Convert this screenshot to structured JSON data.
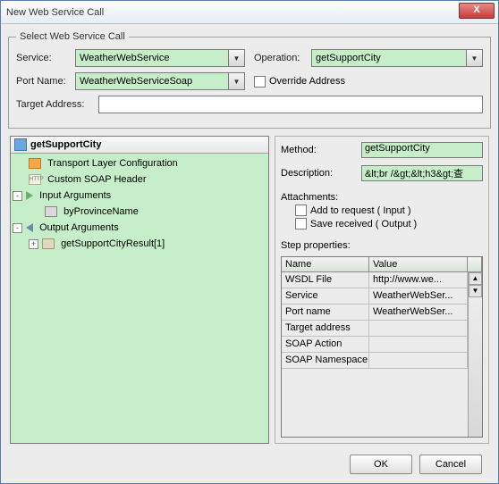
{
  "window": {
    "title": "New Web Service Call",
    "close": "X"
  },
  "group": {
    "legend": "Select Web Service Call"
  },
  "labels": {
    "service": "Service:",
    "operation": "Operation:",
    "portName": "Port Name:",
    "override": "Override Address",
    "targetAddress": "Target Address:"
  },
  "values": {
    "service": "WeatherWebService",
    "operation": "getSupportCity",
    "portName": "WeatherWebServiceSoap",
    "targetAddress": ""
  },
  "tree": {
    "root": "getSupportCity",
    "transport": "Transport Layer Configuration",
    "soapHeader": "Custom SOAP Header",
    "inputArgs": "Input Arguments",
    "byProv": "byProvinceName",
    "outputArgs": "Output Arguments",
    "result": "getSupportCityResult[1]"
  },
  "right": {
    "methodLabel": "Method:",
    "methodValue": "getSupportCity",
    "descLabel": "Description:",
    "descValue": "&lt;br /&gt;&lt;h3&gt;查",
    "attachments": "Attachments:",
    "addReq": "Add to request ( Input )",
    "saveRec": "Save received ( Output )",
    "stepProps": "Step properties:"
  },
  "props": {
    "headers": {
      "name": "Name",
      "value": "Value"
    },
    "rows": [
      {
        "name": "WSDL File",
        "value": "http://www.we..."
      },
      {
        "name": "Service",
        "value": "WeatherWebSer..."
      },
      {
        "name": "Port name",
        "value": "WeatherWebSer..."
      },
      {
        "name": "Target address",
        "value": ""
      },
      {
        "name": "SOAP Action",
        "value": ""
      },
      {
        "name": "SOAP Namespace",
        "value": ""
      }
    ]
  },
  "buttons": {
    "ok": "OK",
    "cancel": "Cancel"
  }
}
